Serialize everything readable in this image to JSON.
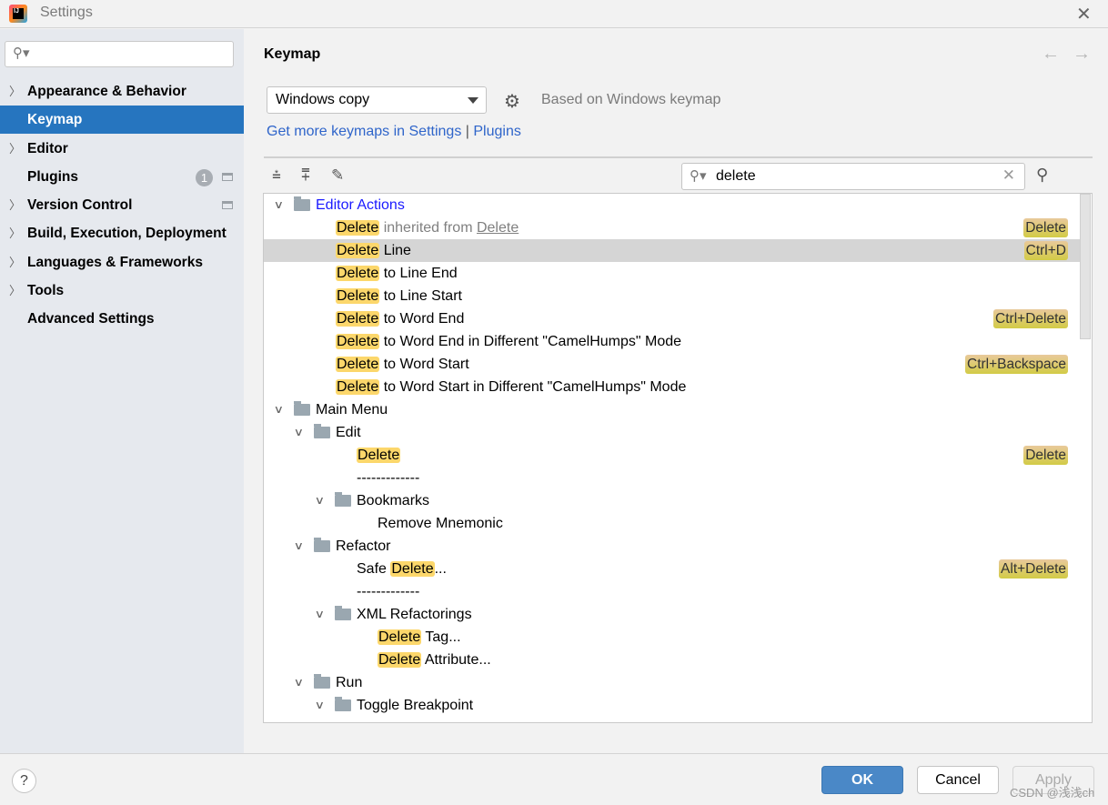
{
  "window": {
    "title": "Settings",
    "close_icon": "close-icon"
  },
  "sidebar": {
    "search_placeholder": "",
    "items": [
      {
        "label": "Appearance & Behavior",
        "expandable": true
      },
      {
        "label": "Keymap",
        "expandable": false,
        "selected": true
      },
      {
        "label": "Editor",
        "expandable": true
      },
      {
        "label": "Plugins",
        "expandable": false,
        "badge": "1",
        "project_icon": true
      },
      {
        "label": "Version Control",
        "expandable": true,
        "project_icon": true
      },
      {
        "label": "Build, Execution, Deployment",
        "expandable": true
      },
      {
        "label": "Languages & Frameworks",
        "expandable": true
      },
      {
        "label": "Tools",
        "expandable": true
      },
      {
        "label": "Advanced Settings",
        "expandable": false
      }
    ]
  },
  "main": {
    "heading": "Keymap",
    "keymap_select": "Windows copy",
    "based_on": "Based on Windows keymap",
    "links": {
      "get_more": "Get more keymaps in Settings",
      "separator": "|",
      "plugins": "Plugins"
    },
    "filter": {
      "value": "delete",
      "placeholder": ""
    },
    "tree": [
      {
        "depth": 0,
        "expander": true,
        "icon": "editor-actions-folder",
        "text": "Editor Actions",
        "style": "blue"
      },
      {
        "depth": 1,
        "hl": "Delete",
        "gray": " inherited from ",
        "link": "Delete",
        "shortcut": "Delete"
      },
      {
        "depth": 1,
        "hl": "Delete",
        "text": " Line",
        "shortcut": "Ctrl+D",
        "selected": true
      },
      {
        "depth": 1,
        "hl": "Delete",
        "text": " to Line End"
      },
      {
        "depth": 1,
        "hl": "Delete",
        "text": " to Line Start"
      },
      {
        "depth": 1,
        "hl": "Delete",
        "text": " to Word End",
        "shortcut": "Ctrl+Delete"
      },
      {
        "depth": 1,
        "hl": "Delete",
        "text": " to Word End in Different \"CamelHumps\" Mode"
      },
      {
        "depth": 1,
        "hl": "Delete",
        "text": " to Word Start",
        "shortcut": "Ctrl+Backspace"
      },
      {
        "depth": 1,
        "hl": "Delete",
        "text": " to Word Start in Different \"CamelHumps\" Mode"
      },
      {
        "depth": 0,
        "expander": true,
        "icon": "main-menu-folder",
        "text": "Main Menu"
      },
      {
        "depth": 1,
        "expander": true,
        "icon": "folder",
        "text": "Edit"
      },
      {
        "depth": 2,
        "hl": "Delete",
        "shortcut": "Delete"
      },
      {
        "depth": 2,
        "text": "-------------"
      },
      {
        "depth": 2,
        "expander": true,
        "icon": "folder",
        "text": "Bookmarks"
      },
      {
        "depth": 3,
        "text": "Remove Mnemonic"
      },
      {
        "depth": 1,
        "expander": true,
        "icon": "folder",
        "text": "Refactor"
      },
      {
        "depth": 2,
        "pre": "Safe ",
        "hl": "Delete",
        "text": "...",
        "shortcut": "Alt+Delete"
      },
      {
        "depth": 2,
        "text": "-------------"
      },
      {
        "depth": 2,
        "expander": true,
        "icon": "folder",
        "text": "XML Refactorings"
      },
      {
        "depth": 3,
        "hl": "Delete",
        "text": " Tag..."
      },
      {
        "depth": 3,
        "hl": "Delete",
        "text": " Attribute..."
      },
      {
        "depth": 1,
        "expander": true,
        "icon": "folder",
        "text": "Run"
      },
      {
        "depth": 2,
        "expander": true,
        "icon": "folder",
        "text": "Toggle Breakpoint"
      }
    ]
  },
  "footer": {
    "help": "?",
    "ok": "OK",
    "cancel": "Cancel",
    "apply": "Apply"
  },
  "watermark": "CSDN @浅浅ch",
  "colors": {
    "accent": "#2675bf",
    "highlight": "#fcd76b",
    "link": "#2f65ca"
  }
}
